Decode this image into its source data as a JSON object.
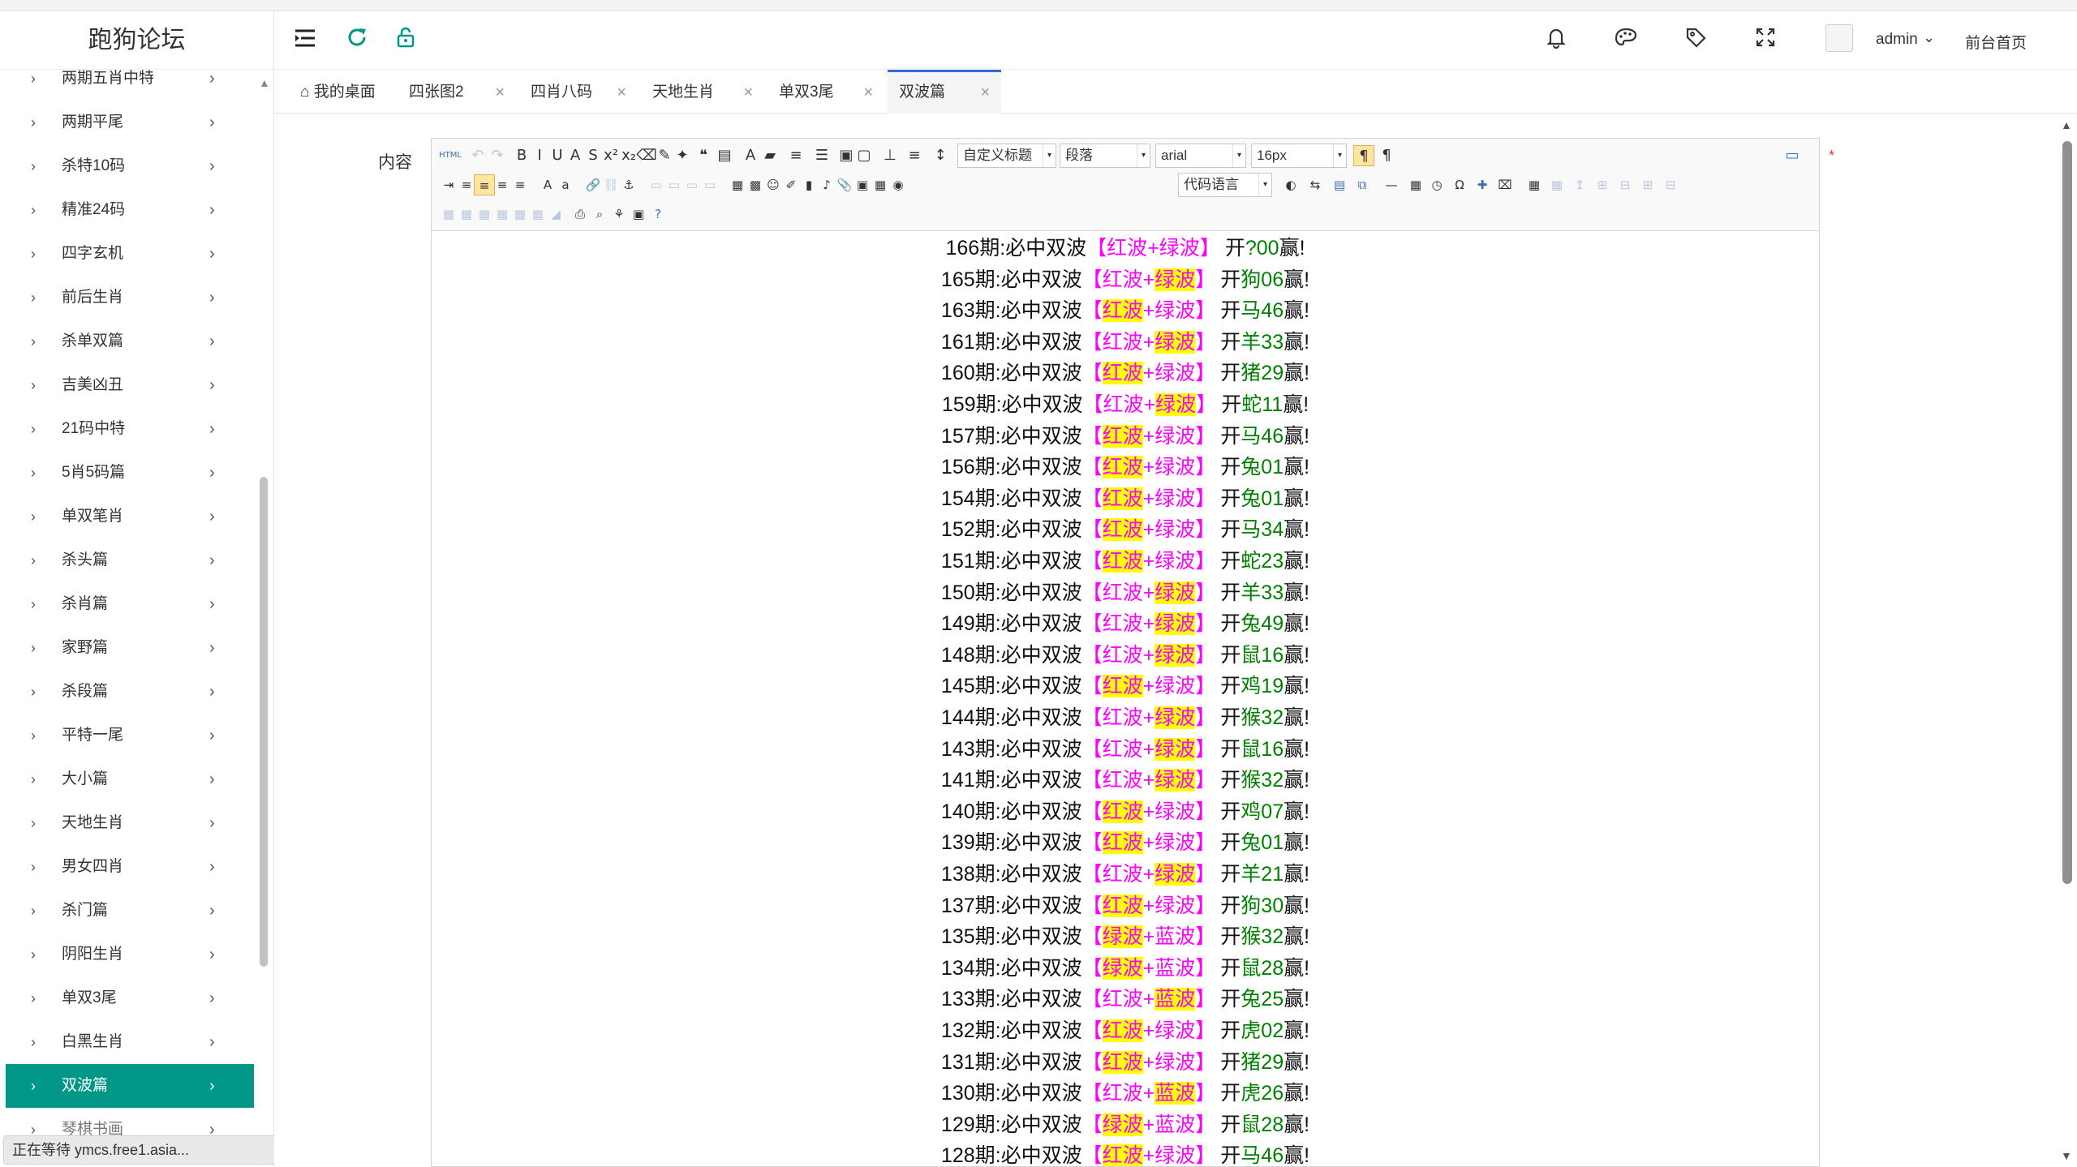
{
  "sidebar": {
    "title": "跑狗论坛",
    "items": [
      "两期五肖中特",
      "两期平尾",
      "杀特10码",
      "精准24码",
      "四字玄机",
      "前后生肖",
      "杀单双篇",
      "吉美凶丑",
      "21码中特",
      "5肖5码篇",
      "单双笔肖",
      "杀头篇",
      "杀肖篇",
      "家野篇",
      "杀段篇",
      "平特一尾",
      "大小篇",
      "天地生肖",
      "男女四肖",
      "杀门篇",
      "阴阳生肖",
      "单双3尾",
      "白黑生肖"
    ],
    "active_item": "双波篇",
    "partial_item": "琴棋书画"
  },
  "status_text": "正在等待 ymcs.free1.asia...",
  "header": {
    "username": "admin",
    "front_page_link": "前台首页",
    "icons": [
      "menu-toggle-icon",
      "refresh-icon",
      "unlock-icon",
      "bell-icon",
      "theme-palette-icon",
      "tag-icon",
      "fullscreen-icon"
    ]
  },
  "tabs": [
    {
      "label": "我的桌面",
      "closable": false
    },
    {
      "label": "四张图2",
      "closable": true
    },
    {
      "label": "四肖八码",
      "closable": true
    },
    {
      "label": "天地生肖",
      "closable": true
    },
    {
      "label": "单双3尾",
      "closable": true
    },
    {
      "label": "双波篇",
      "closable": true,
      "active": true
    }
  ],
  "form": {
    "content_label": "内容",
    "required_mark": "*"
  },
  "editor": {
    "selects": [
      {
        "name": "custom-title-select",
        "value": "自定义标题"
      },
      {
        "name": "paragraph-format-select",
        "value": "段落"
      },
      {
        "name": "font-family-select",
        "value": "arial"
      },
      {
        "name": "font-size-select",
        "value": "16px"
      },
      {
        "name": "code-language-select",
        "value": "代码语言"
      }
    ],
    "line_prefix": "期:必中双波",
    "line_suffix_open": "开",
    "line_suffix_close": "赢!",
    "lines": [
      {
        "period": "166",
        "waves": [
          "红波",
          "绿波"
        ],
        "hl": -1,
        "zodiac": "?",
        "num": "00"
      },
      {
        "period": "165",
        "waves": [
          "红波",
          "绿波"
        ],
        "hl": 1,
        "zodiac": "狗",
        "num": "06"
      },
      {
        "period": "163",
        "waves": [
          "红波",
          "绿波"
        ],
        "hl": 0,
        "zodiac": "马",
        "num": "46"
      },
      {
        "period": "161",
        "waves": [
          "红波",
          "绿波"
        ],
        "hl": 1,
        "zodiac": "羊",
        "num": "33"
      },
      {
        "period": "160",
        "waves": [
          "红波",
          "绿波"
        ],
        "hl": 0,
        "zodiac": "猪",
        "num": "29"
      },
      {
        "period": "159",
        "waves": [
          "红波",
          "绿波"
        ],
        "hl": 1,
        "zodiac": "蛇",
        "num": "11"
      },
      {
        "period": "157",
        "waves": [
          "红波",
          "绿波"
        ],
        "hl": 0,
        "zodiac": "马",
        "num": "46"
      },
      {
        "period": "156",
        "waves": [
          "红波",
          "绿波"
        ],
        "hl": 0,
        "zodiac": "兔",
        "num": "01"
      },
      {
        "period": "154",
        "waves": [
          "红波",
          "绿波"
        ],
        "hl": 0,
        "zodiac": "兔",
        "num": "01"
      },
      {
        "period": "152",
        "waves": [
          "红波",
          "绿波"
        ],
        "hl": 0,
        "zodiac": "马",
        "num": "34"
      },
      {
        "period": "151",
        "waves": [
          "红波",
          "绿波"
        ],
        "hl": 0,
        "zodiac": "蛇",
        "num": "23"
      },
      {
        "period": "150",
        "waves": [
          "红波",
          "绿波"
        ],
        "hl": 1,
        "zodiac": "羊",
        "num": "33"
      },
      {
        "period": "149",
        "waves": [
          "红波",
          "绿波"
        ],
        "hl": 1,
        "zodiac": "兔",
        "num": "49"
      },
      {
        "period": "148",
        "waves": [
          "红波",
          "绿波"
        ],
        "hl": 1,
        "zodiac": "鼠",
        "num": "16"
      },
      {
        "period": "145",
        "waves": [
          "红波",
          "绿波"
        ],
        "hl": 0,
        "zodiac": "鸡",
        "num": "19"
      },
      {
        "period": "144",
        "waves": [
          "红波",
          "绿波"
        ],
        "hl": 1,
        "zodiac": "猴",
        "num": "32"
      },
      {
        "period": "143",
        "waves": [
          "红波",
          "绿波"
        ],
        "hl": 1,
        "zodiac": "鼠",
        "num": "16"
      },
      {
        "period": "141",
        "waves": [
          "红波",
          "绿波"
        ],
        "hl": 1,
        "zodiac": "猴",
        "num": "32"
      },
      {
        "period": "140",
        "waves": [
          "红波",
          "绿波"
        ],
        "hl": 0,
        "zodiac": "鸡",
        "num": "07"
      },
      {
        "period": "139",
        "waves": [
          "红波",
          "绿波"
        ],
        "hl": 0,
        "zodiac": "兔",
        "num": "01"
      },
      {
        "period": "138",
        "waves": [
          "红波",
          "绿波"
        ],
        "hl": 1,
        "zodiac": "羊",
        "num": "21"
      },
      {
        "period": "137",
        "waves": [
          "红波",
          "绿波"
        ],
        "hl": 0,
        "zodiac": "狗",
        "num": "30"
      },
      {
        "period": "135",
        "waves": [
          "绿波",
          "蓝波"
        ],
        "hl": 0,
        "zodiac": "猴",
        "num": "32"
      },
      {
        "period": "134",
        "waves": [
          "绿波",
          "蓝波"
        ],
        "hl": 0,
        "zodiac": "鼠",
        "num": "28"
      },
      {
        "period": "133",
        "waves": [
          "红波",
          "蓝波"
        ],
        "hl": 1,
        "zodiac": "兔",
        "num": "25"
      },
      {
        "period": "132",
        "waves": [
          "红波",
          "绿波"
        ],
        "hl": 0,
        "zodiac": "虎",
        "num": "02"
      },
      {
        "period": "131",
        "waves": [
          "红波",
          "绿波"
        ],
        "hl": 0,
        "zodiac": "猪",
        "num": "29"
      },
      {
        "period": "130",
        "waves": [
          "红波",
          "蓝波"
        ],
        "hl": 1,
        "zodiac": "虎",
        "num": "26"
      },
      {
        "period": "129",
        "waves": [
          "绿波",
          "蓝波"
        ],
        "hl": 0,
        "zodiac": "鼠",
        "num": "28"
      },
      {
        "period": "128",
        "waves": [
          "红波",
          "绿波"
        ],
        "hl": 0,
        "zodiac": "马",
        "num": "46"
      }
    ]
  }
}
